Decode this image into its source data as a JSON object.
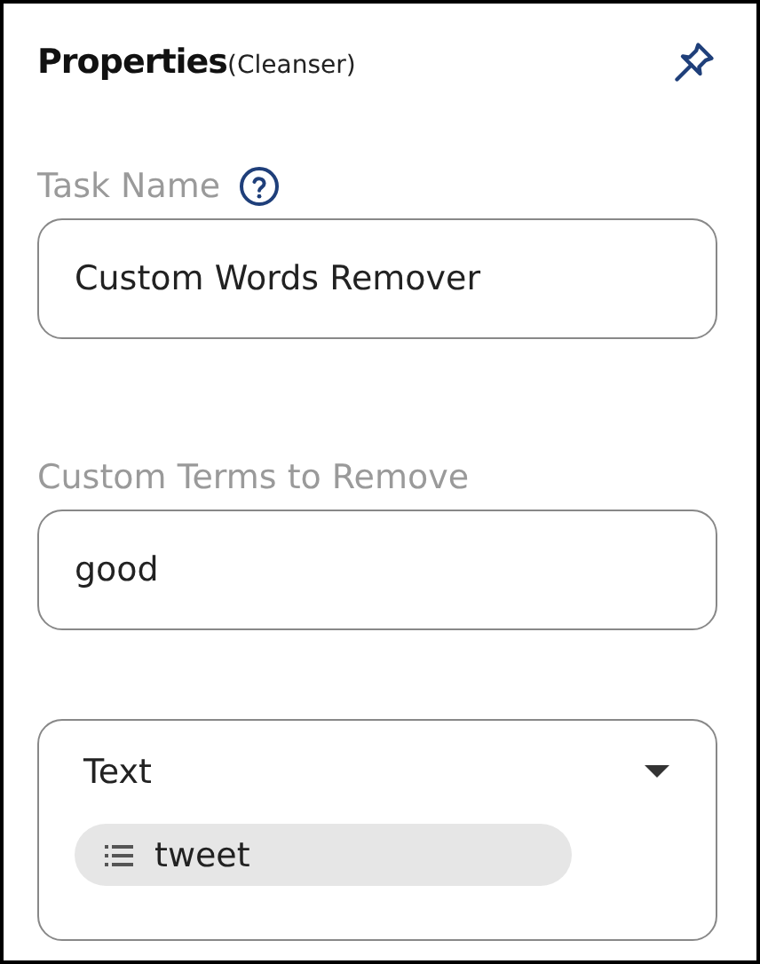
{
  "header": {
    "title": "Properties",
    "subtitle": "(Cleanser)"
  },
  "fields": [
    {
      "kind": "input",
      "label": "Task Name",
      "help": true,
      "value": "Custom Words Remover"
    },
    {
      "kind": "input",
      "label": "Custom Terms to Remove",
      "help": false,
      "value": "good"
    }
  ],
  "column_select": {
    "value": "Text",
    "chips": [
      "tweet"
    ]
  }
}
